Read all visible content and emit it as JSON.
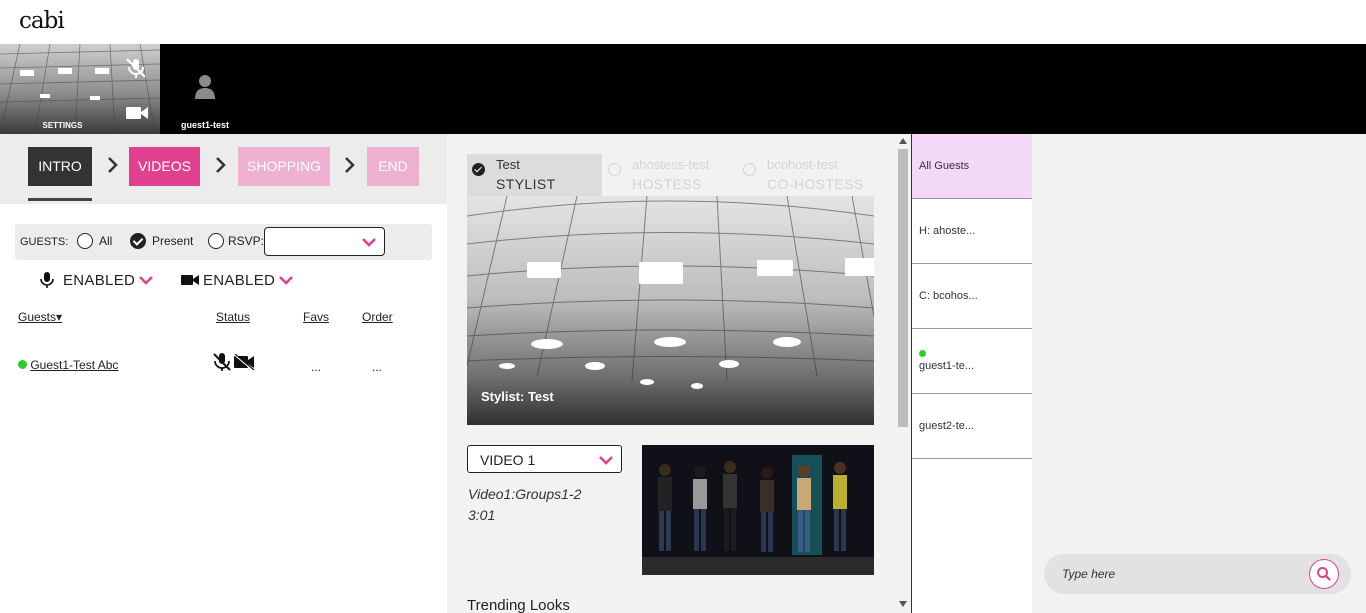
{
  "header": {
    "logo": "cabi"
  },
  "video_strip": {
    "self_label": "SETTINGS",
    "peer_name": "guest1-test"
  },
  "steps": [
    {
      "label": "INTRO",
      "state": "done"
    },
    {
      "label": "VIDEOS",
      "state": "active"
    },
    {
      "label": "SHOPPING",
      "state": "pending"
    },
    {
      "label": "END",
      "state": "pending"
    }
  ],
  "guests_filter": {
    "label": "GUESTS:",
    "options": [
      "All",
      "Present",
      "RSVP:"
    ],
    "selected": "Present",
    "rsvp_value": ""
  },
  "media": {
    "mic": "ENABLED",
    "camera": "ENABLED"
  },
  "table": {
    "headers": [
      "Guests",
      "Status",
      "Favs",
      "Order"
    ],
    "rows": [
      {
        "name": "Guest1-Test Abc",
        "favs": "...",
        "order": "..."
      }
    ]
  },
  "host_tabs": [
    {
      "name": "Test",
      "role": "STYLIST",
      "active": true
    },
    {
      "name": "ahostess-test",
      "role": "HOSTESS",
      "active": false
    },
    {
      "name": "bcohost-test",
      "role": "CO-HOSTESS",
      "active": false
    }
  ],
  "main_video": {
    "caption": "Stylist: Test"
  },
  "video_select": {
    "value": "VIDEO 1",
    "title": "Video1:Groups1-2",
    "duration": "3:01"
  },
  "trending_label": "Trending Looks",
  "guest_list": [
    {
      "label": "All Guests",
      "selected": true,
      "online": false
    },
    {
      "label": "H: ahoste...",
      "selected": false,
      "online": false
    },
    {
      "label": "C: bcohos...",
      "selected": false,
      "online": false
    },
    {
      "label": "guest1-te...",
      "selected": false,
      "online": true
    },
    {
      "label": "guest2-te...",
      "selected": false,
      "online": false
    }
  ],
  "chat": {
    "placeholder": "Type here"
  },
  "colors": {
    "accent": "#e0418f",
    "accent_light": "#eeb1cf",
    "selected_row": "#f4d9f6",
    "online": "#2ecc2e"
  }
}
